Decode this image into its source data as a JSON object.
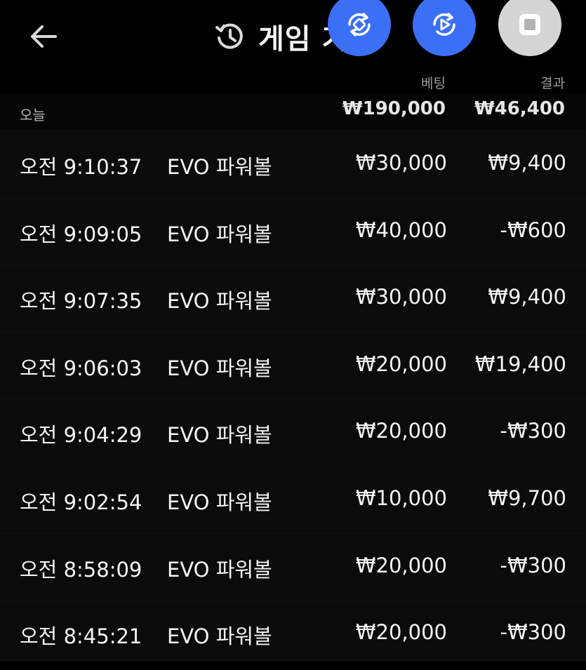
{
  "header": {
    "title": "게임 기",
    "back_icon": "arrow-left-icon",
    "history_icon": "history-icon"
  },
  "floating_buttons": [
    {
      "icon": "sync-icon",
      "color": "#3b6ff5"
    },
    {
      "icon": "replay-play-icon",
      "color": "#3b6ff5"
    },
    {
      "icon": "stop-square-icon",
      "color": "#d5d5d5"
    }
  ],
  "columns": {
    "bet": "베팅",
    "result": "결과"
  },
  "summary": {
    "day": "오늘",
    "bet_total": "₩190,000",
    "result_total": "₩46,400"
  },
  "rows": [
    {
      "time": "오전 9:10:37",
      "game": "EVO 파워볼",
      "bet": "₩30,000",
      "result": "₩9,400"
    },
    {
      "time": "오전 9:09:05",
      "game": "EVO 파워볼",
      "bet": "₩40,000",
      "result": "-₩600"
    },
    {
      "time": "오전 9:07:35",
      "game": "EVO 파워볼",
      "bet": "₩30,000",
      "result": "₩9,400"
    },
    {
      "time": "오전 9:06:03",
      "game": "EVO 파워볼",
      "bet": "₩20,000",
      "result": "₩19,400"
    },
    {
      "time": "오전 9:04:29",
      "game": "EVO 파워볼",
      "bet": "₩20,000",
      "result": "-₩300"
    },
    {
      "time": "오전 9:02:54",
      "game": "EVO 파워볼",
      "bet": "₩10,000",
      "result": "₩9,700"
    },
    {
      "time": "오전 8:58:09",
      "game": "EVO 파워볼",
      "bet": "₩20,000",
      "result": "-₩300"
    },
    {
      "time": "오전 8:45:21",
      "game": "EVO 파워볼",
      "bet": "₩20,000",
      "result": "-₩300"
    }
  ]
}
